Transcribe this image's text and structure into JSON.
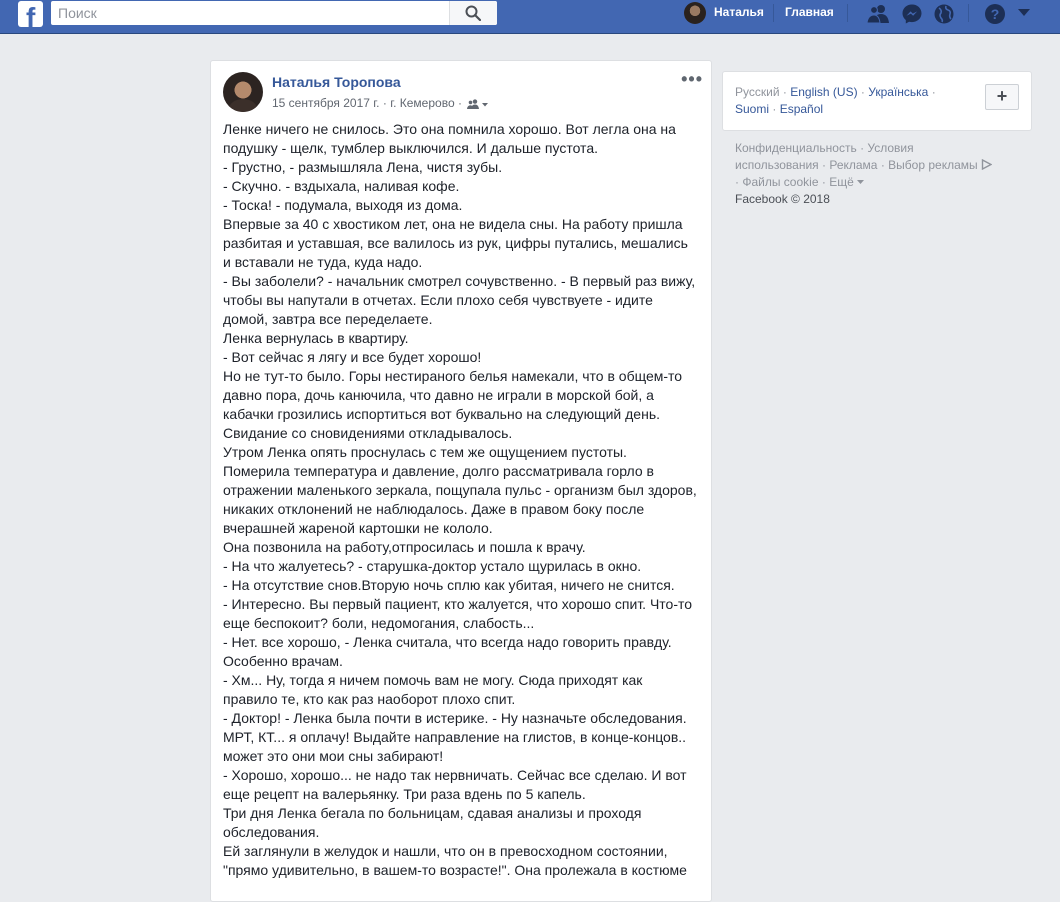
{
  "topbar": {
    "search_placeholder": "Поиск",
    "user_name": "Наталья",
    "home_label": "Главная",
    "icons": [
      "friends-icon",
      "messenger-icon",
      "globe-icon",
      "help-icon",
      "caret-down-icon"
    ]
  },
  "post": {
    "author": "Наталья Торопова",
    "date": "15 сентября 2017 г.",
    "location": "г. Кемерово",
    "meta_separator": "·",
    "more_label": "•••",
    "lines": [
      "Ленке ничего не снилось. Это она помнила хорошо. Вот легла она на",
      "подушку - щелк, тумблер выключился. И дальше пустота.",
      "- Грустно, - размышляла Лена, чистя зубы.",
      "- Скучно. - вздыхала, наливая кофе.",
      "- Тоска! - подумала, выходя из дома.",
      "Впервые за 40 с хвостиком лет, она не видела сны. На работу пришла",
      "разбитая и уставшая, все валилось из рук, цифры путались, мешались",
      "и вставали не туда, куда надо.",
      "- Вы заболели? - начальник смотрел сочувственно. - В первый раз вижу,",
      "чтобы вы напутали в отчетах. Если плохо себя чувствуете - идите",
      "домой, завтра все переделаете.",
      "Ленка вернулась в квартиру.",
      "- Вот сейчас я лягу и все будет хорошо!",
      "Но не тут-то было. Горы нестираного белья намекали, что в общем-то",
      "давно пора, дочь канючила, что давно не играли в морской бой, а",
      "кабачки грозились испортиться вот буквально на следующий день.",
      "Свидание со сновидениями откладывалось.",
      "Утром Ленка опять проснулась с тем же ощущением пустоты.",
      "Померила температура и давление, долго рассматривала горло в",
      "отражении маленького зеркала, пощупала пульс - организм был здоров,",
      "никаких отклонений не наблюдалось. Даже в правом боку после",
      "вчерашней жареной картошки не кололо.",
      "Она позвонила на работу,отпросилась и пошла к врачу.",
      "- На что жалуетесь? - старушка-доктор устало щурилась в окно.",
      "- На отсутствие снов.Вторую ночь сплю как убитая, ничего не снится.",
      "- Интересно. Вы первый пациент, кто жалуется, что хорошо спит. Что-то",
      "еще беспокоит? боли, недомогания, слабость...",
      "- Нет. все хорошо, - Ленка считала, что всегда надо говорить правду.",
      "Особенно врачам.",
      "- Хм... Ну, тогда я ничем помочь вам не могу. Сюда приходят как",
      "правило те, кто как раз наоборот плохо спит.",
      "- Доктор! - Ленка была почти в истерике. - Ну назначьте обследования.",
      "МРТ, КТ... я оплачу! Выдайте направление на глистов, в конце-концов..",
      "может это они мои сны забирают!",
      "- Хорошо, хорошо... не надо так нервничать. Сейчас все сделаю. И вот",
      "еще рецепт на валерьянку. Три раза вдень по 5 капель.",
      "Три дня Ленка бегала по больницам, сдавая анализы и проходя",
      "обследования.",
      "Ей заглянули в желудок и нашли, что он в превосходном состоянии,",
      "\"прямо удивительно, в вашем-то возрасте!\". Она пролежала в костюме"
    ]
  },
  "sidebar": {
    "languages": {
      "current": "Русский",
      "options": [
        "English (US)",
        "Українська",
        "Suomi",
        "Español"
      ],
      "add_label": "+"
    },
    "footer": {
      "privacy": "Конфиденциальность",
      "terms_1": "Условия",
      "terms_2": "использования",
      "ads": "Реклама",
      "ad_choices": "Выбор рекламы",
      "cookies": "Файлы cookie",
      "more": "Ещё",
      "copyright": "Facebook © 2018"
    }
  }
}
